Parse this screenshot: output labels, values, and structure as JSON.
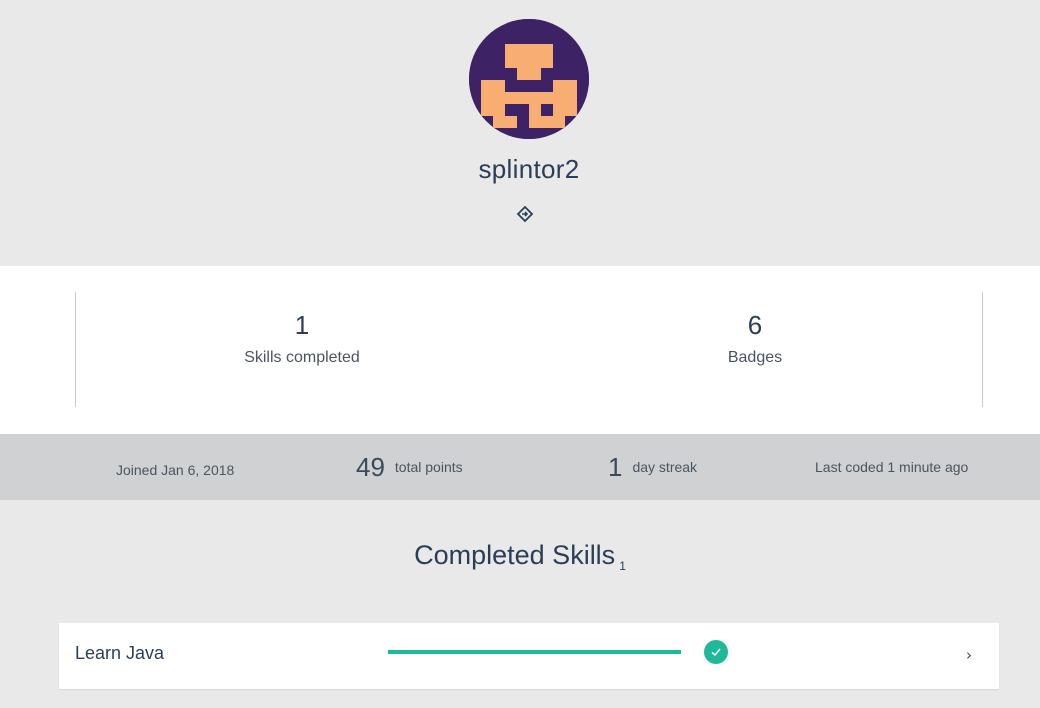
{
  "profile": {
    "username": "splintor2"
  },
  "stats": {
    "skills_completed_value": "1",
    "skills_completed_label": "Skills completed",
    "badges_value": "6",
    "badges_label": "Badges"
  },
  "activity": {
    "joined": "Joined Jan 6, 2018",
    "total_points_value": "49",
    "total_points_label": "total points",
    "streak_value": "1",
    "streak_label": "day streak",
    "last_coded": "Last coded 1 minute ago"
  },
  "completed_skills": {
    "title": "Completed Skills",
    "count": "1",
    "items": [
      {
        "name": "Learn Java",
        "progress": 1.0,
        "completed": true
      }
    ]
  },
  "icons": {
    "repo": "repository-link-icon",
    "check": "check-icon",
    "chevron": "chevron-right-icon"
  },
  "colors": {
    "avatar_bg": "#3d2366",
    "avatar_fg": "#f8ae73",
    "accent": "#1fb99a",
    "title": "#2c3e57"
  }
}
